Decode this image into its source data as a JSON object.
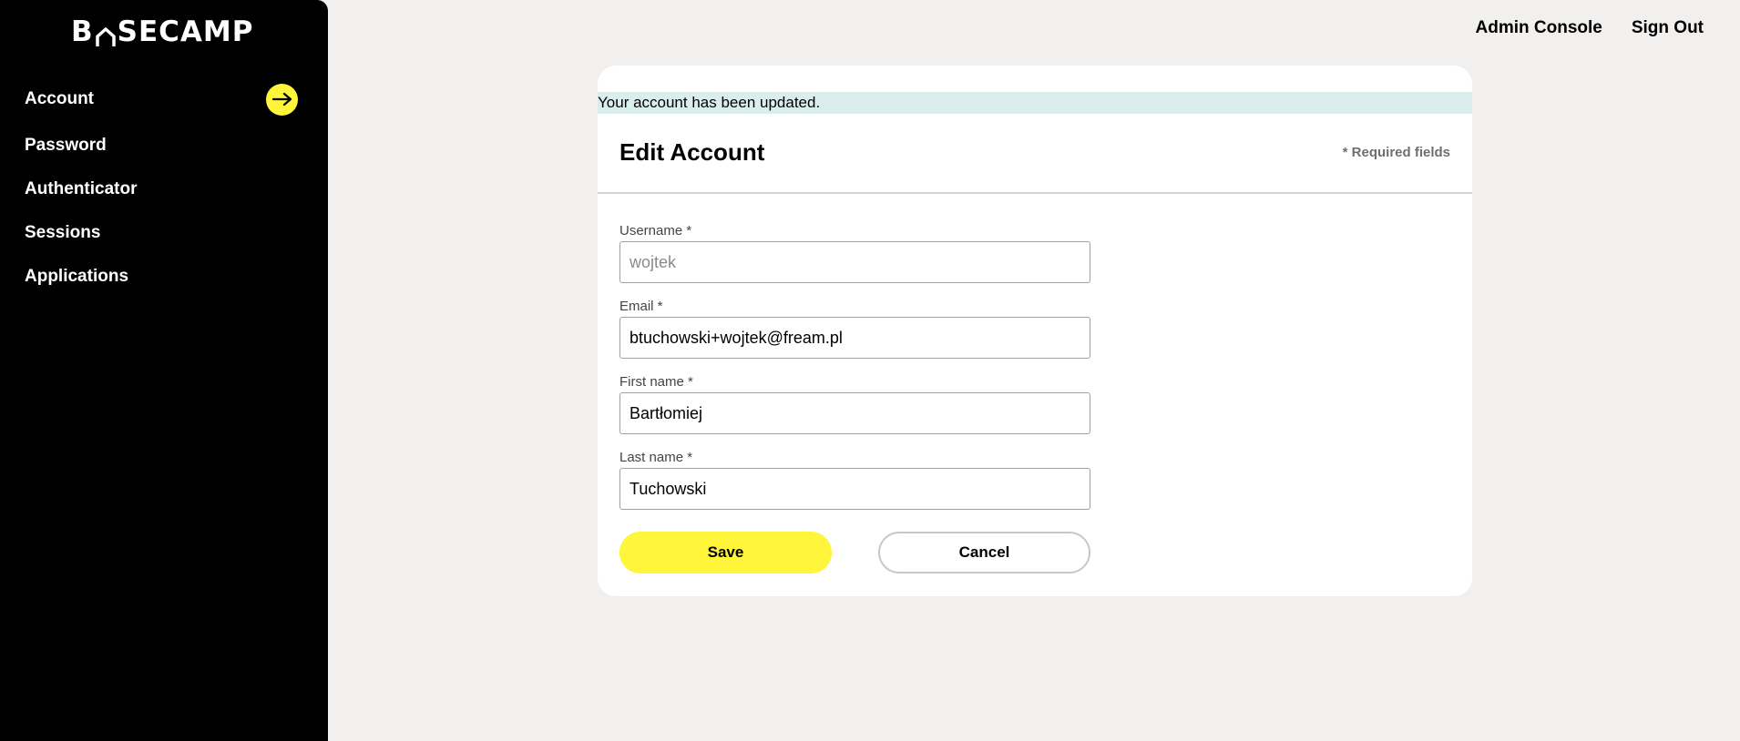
{
  "brand": {
    "logo_text_left": "B",
    "logo_text_right": "SECAMP",
    "accent": "#fff53a",
    "sidebar_bg": "#000000",
    "alert_bg": "#dbeeee"
  },
  "sidebar": {
    "items": [
      {
        "label": "Account",
        "icon": "arrow-right-icon"
      },
      {
        "label": "Password"
      },
      {
        "label": "Authenticator"
      },
      {
        "label": "Sessions"
      },
      {
        "label": "Applications"
      }
    ]
  },
  "topnav": {
    "admin_console": "Admin Console",
    "sign_out": "Sign Out"
  },
  "alert": {
    "message": "Your account has been updated."
  },
  "form": {
    "title": "Edit Account",
    "required_note": "* Required fields",
    "fields": [
      {
        "label": "Username *",
        "value": "",
        "placeholder": "wojtek"
      },
      {
        "label": "Email *",
        "value": "btuchowski+wojtek@fream.pl",
        "placeholder": ""
      },
      {
        "label": "First name *",
        "value": "Bartłomiej",
        "placeholder": ""
      },
      {
        "label": "Last name *",
        "value": "Tuchowski",
        "placeholder": ""
      }
    ],
    "save_label": "Save",
    "cancel_label": "Cancel"
  }
}
